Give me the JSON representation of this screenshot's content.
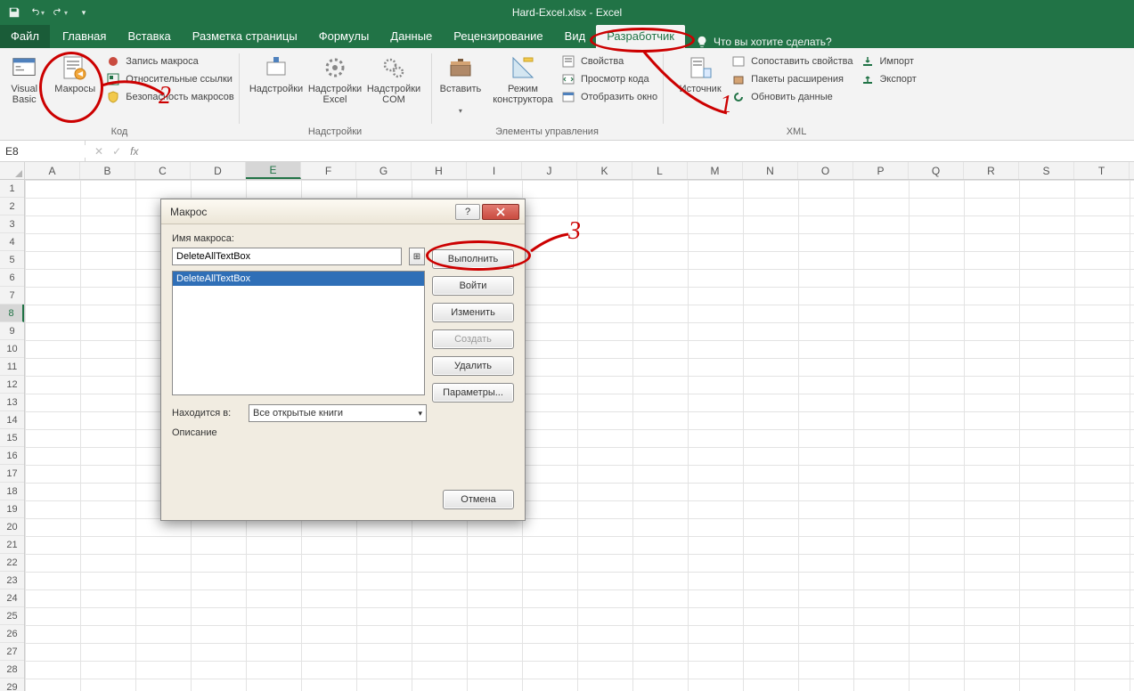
{
  "titlebar": {
    "title": "Hard-Excel.xlsx - Excel"
  },
  "tabs": {
    "file": "Файл",
    "items": [
      "Главная",
      "Вставка",
      "Разметка страницы",
      "Формулы",
      "Данные",
      "Рецензирование",
      "Вид",
      "Разработчик"
    ],
    "active": "Разработчик",
    "tell_me": "Что вы хотите сделать?"
  },
  "ribbon": {
    "code": {
      "vb": "Visual\nBasic",
      "macros": "Макросы",
      "record": "Запись макроса",
      "relative": "Относительные ссылки",
      "security": "Безопасность макросов",
      "group": "Код"
    },
    "addins": {
      "addins": "Надстройки",
      "excel_addins": "Надстройки\nExcel",
      "com": "Надстройки\nCOM",
      "group": "Надстройки"
    },
    "controls": {
      "insert": "Вставить",
      "design": "Режим\nконструктора",
      "props": "Свойства",
      "view_code": "Просмотр кода",
      "show_dlg": "Отобразить окно",
      "group": "Элементы управления"
    },
    "xml": {
      "source": "Источник",
      "map_props": "Сопоставить свойства",
      "exp_packs": "Пакеты расширения",
      "refresh": "Обновить данные",
      "import": "Импорт",
      "export": "Экспорт",
      "group": "XML"
    }
  },
  "formula_bar": {
    "cell_ref": "E8",
    "formula": ""
  },
  "grid": {
    "cols": [
      "A",
      "B",
      "C",
      "D",
      "E",
      "F",
      "G",
      "H",
      "I",
      "J",
      "K",
      "L",
      "M",
      "N",
      "O",
      "P",
      "Q",
      "R",
      "S",
      "T"
    ],
    "rows": 29,
    "sel_col": "E",
    "sel_row": 8
  },
  "dialog": {
    "title": "Макрос",
    "name_label": "Имя макроса:",
    "name_value": "DeleteAllTextBox",
    "list": [
      "DeleteAllTextBox"
    ],
    "selected": "DeleteAllTextBox",
    "buttons": {
      "run": "Выполнить",
      "step": "Войти",
      "edit": "Изменить",
      "create": "Создать",
      "delete": "Удалить",
      "options": "Параметры...",
      "cancel": "Отмена"
    },
    "location_label": "Находится в:",
    "location_value": "Все открытые книги",
    "description_label": "Описание"
  },
  "annotations": {
    "n1": "1",
    "n2": "2",
    "n3": "3"
  }
}
